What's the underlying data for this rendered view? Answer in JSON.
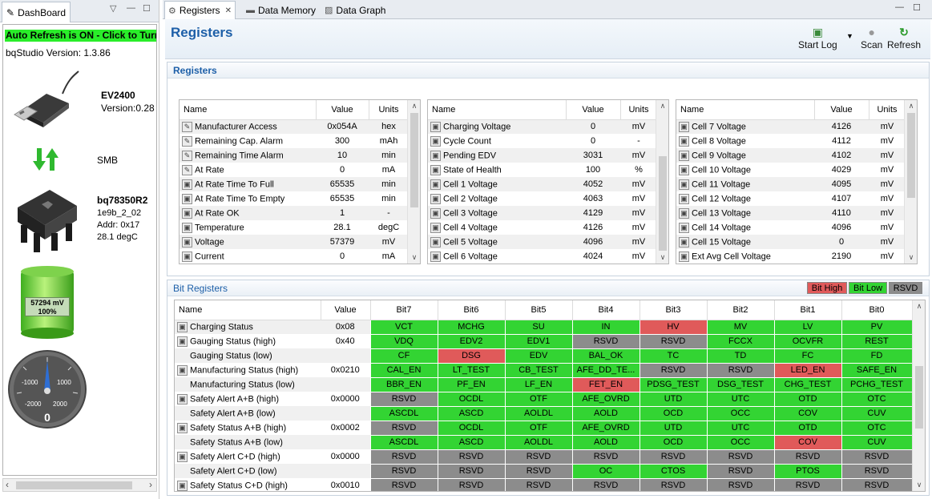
{
  "dashboard": {
    "tab_label": "DashBoard",
    "auto_refresh": "Auto Refresh is ON - Click to Turn",
    "version": "bqStudio Version:  1.3.86",
    "device_name": "EV2400",
    "device_version": "Version:0.28",
    "bus": "SMB",
    "chip_name": "bq78350R2",
    "chip_lines": [
      "1e9b_2_02",
      "Addr: 0x17",
      "28.1 degC"
    ],
    "battery_mv": "57294 mV",
    "battery_pct": "100%",
    "battery_level": 1.0,
    "gauge_labels": {
      "neg1000": "-1000",
      "pos1000": "1000",
      "neg2000": "-2000",
      "pos2000": "2000",
      "value": "0"
    },
    "gauge_value": 0
  },
  "tabs": [
    {
      "label": "Registers",
      "icon": "gear-icon"
    },
    {
      "label": "Data Memory",
      "icon": "memory-chip-icon"
    },
    {
      "label": "Data Graph",
      "icon": "graph-icon"
    }
  ],
  "header": {
    "title": "Registers",
    "start_log": "Start Log",
    "scan": "Scan",
    "refresh": "Refresh"
  },
  "registers": {
    "section_title": "Registers",
    "columns": {
      "name": "Name",
      "value": "Value",
      "units": "Units"
    },
    "table1": [
      {
        "icon": "pencil-icon",
        "name": "Manufacturer Access",
        "value": "0x054A",
        "units": "hex"
      },
      {
        "icon": "pencil-icon",
        "name": "Remaining Cap. Alarm",
        "value": "300",
        "units": "mAh"
      },
      {
        "icon": "pencil-icon",
        "name": "Remaining Time Alarm",
        "value": "10",
        "units": "min"
      },
      {
        "icon": "pencil-icon",
        "name": "At Rate",
        "value": "0",
        "units": "mA"
      },
      {
        "icon": "lock-icon",
        "name": "At Rate Time To Full",
        "value": "65535",
        "units": "min"
      },
      {
        "icon": "lock-icon",
        "name": "At Rate Time To Empty",
        "value": "65535",
        "units": "min"
      },
      {
        "icon": "lock-icon",
        "name": "At Rate OK",
        "value": "1",
        "units": "-"
      },
      {
        "icon": "lock-icon",
        "name": "Temperature",
        "value": "28.1",
        "units": "degC"
      },
      {
        "icon": "lock-icon",
        "name": "Voltage",
        "value": "57379",
        "units": "mV"
      },
      {
        "icon": "lock-icon",
        "name": "Current",
        "value": "0",
        "units": "mA"
      }
    ],
    "table2": [
      {
        "icon": "lock-icon",
        "name": "Charging Voltage",
        "value": "0",
        "units": "mV"
      },
      {
        "icon": "lock-icon",
        "name": "Cycle Count",
        "value": "0",
        "units": "-"
      },
      {
        "icon": "lock-icon",
        "name": "Pending EDV",
        "value": "3031",
        "units": "mV"
      },
      {
        "icon": "lock-icon",
        "name": "State of Health",
        "value": "100",
        "units": "%"
      },
      {
        "icon": "lock-icon",
        "name": "Cell 1 Voltage",
        "value": "4052",
        "units": "mV"
      },
      {
        "icon": "lock-icon",
        "name": "Cell 2 Voltage",
        "value": "4063",
        "units": "mV"
      },
      {
        "icon": "lock-icon",
        "name": "Cell 3 Voltage",
        "value": "4129",
        "units": "mV"
      },
      {
        "icon": "lock-icon",
        "name": "Cell 4 Voltage",
        "value": "4126",
        "units": "mV"
      },
      {
        "icon": "lock-icon",
        "name": "Cell 5 Voltage",
        "value": "4096",
        "units": "mV"
      },
      {
        "icon": "lock-icon",
        "name": "Cell 6 Voltage",
        "value": "4024",
        "units": "mV"
      }
    ],
    "table3": [
      {
        "icon": "lock-icon",
        "name": "Cell 7 Voltage",
        "value": "4126",
        "units": "mV"
      },
      {
        "icon": "lock-icon",
        "name": "Cell 8 Voltage",
        "value": "4112",
        "units": "mV"
      },
      {
        "icon": "lock-icon",
        "name": "Cell 9 Voltage",
        "value": "4102",
        "units": "mV"
      },
      {
        "icon": "lock-icon",
        "name": "Cell 10 Voltage",
        "value": "4029",
        "units": "mV"
      },
      {
        "icon": "lock-icon",
        "name": "Cell 11 Voltage",
        "value": "4095",
        "units": "mV"
      },
      {
        "icon": "lock-icon",
        "name": "Cell 12 Voltage",
        "value": "4107",
        "units": "mV"
      },
      {
        "icon": "lock-icon",
        "name": "Cell 13 Voltage",
        "value": "4110",
        "units": "mV"
      },
      {
        "icon": "lock-icon",
        "name": "Cell 14 Voltage",
        "value": "4096",
        "units": "mV"
      },
      {
        "icon": "lock-icon",
        "name": "Cell 15 Voltage",
        "value": "0",
        "units": "mV"
      },
      {
        "icon": "lock-icon",
        "name": "Ext Avg Cell Voltage",
        "value": "2190",
        "units": "mV"
      }
    ]
  },
  "bit_registers": {
    "section_title": "Bit Registers",
    "legend": {
      "high": "Bit High",
      "low": "Bit Low",
      "rsvd": "RSVD"
    },
    "colors": {
      "high": "#e05a5a",
      "low": "#33d433",
      "rsvd": "#8c8c8c"
    },
    "columns": [
      "Name",
      "Value",
      "Bit7",
      "Bit6",
      "Bit5",
      "Bit4",
      "Bit3",
      "Bit2",
      "Bit1",
      "Bit0"
    ],
    "rows": [
      {
        "lock": true,
        "name": "Charging Status",
        "value": "0x08",
        "bits": [
          [
            "VCT",
            "low"
          ],
          [
            "MCHG",
            "low"
          ],
          [
            "SU",
            "low"
          ],
          [
            "IN",
            "low"
          ],
          [
            "HV",
            "high"
          ],
          [
            "MV",
            "low"
          ],
          [
            "LV",
            "low"
          ],
          [
            "PV",
            "low"
          ]
        ]
      },
      {
        "lock": true,
        "name": "Gauging Status (high)",
        "value": "0x40",
        "bits": [
          [
            "VDQ",
            "low"
          ],
          [
            "EDV2",
            "low"
          ],
          [
            "EDV1",
            "low"
          ],
          [
            "RSVD",
            "rsvd"
          ],
          [
            "RSVD",
            "rsvd"
          ],
          [
            "FCCX",
            "low"
          ],
          [
            "OCVFR",
            "low"
          ],
          [
            "REST",
            "low"
          ]
        ]
      },
      {
        "lock": false,
        "name": "Gauging Status (low)",
        "value": "",
        "bits": [
          [
            "CF",
            "low"
          ],
          [
            "DSG",
            "high"
          ],
          [
            "EDV",
            "low"
          ],
          [
            "BAL_OK",
            "low"
          ],
          [
            "TC",
            "low"
          ],
          [
            "TD",
            "low"
          ],
          [
            "FC",
            "low"
          ],
          [
            "FD",
            "low"
          ]
        ]
      },
      {
        "lock": true,
        "name": "Manufacturing Status (high)",
        "value": "0x0210",
        "bits": [
          [
            "CAL_EN",
            "low"
          ],
          [
            "LT_TEST",
            "low"
          ],
          [
            "CB_TEST",
            "low"
          ],
          [
            "AFE_DD_TE...",
            "low"
          ],
          [
            "RSVD",
            "rsvd"
          ],
          [
            "RSVD",
            "rsvd"
          ],
          [
            "LED_EN",
            "high"
          ],
          [
            "SAFE_EN",
            "low"
          ]
        ]
      },
      {
        "lock": false,
        "name": "Manufacturing Status (low)",
        "value": "",
        "bits": [
          [
            "BBR_EN",
            "low"
          ],
          [
            "PF_EN",
            "low"
          ],
          [
            "LF_EN",
            "low"
          ],
          [
            "FET_EN",
            "high"
          ],
          [
            "PDSG_TEST",
            "low"
          ],
          [
            "DSG_TEST",
            "low"
          ],
          [
            "CHG_TEST",
            "low"
          ],
          [
            "PCHG_TEST",
            "low"
          ]
        ]
      },
      {
        "lock": true,
        "name": "Safety Alert A+B (high)",
        "value": "0x0000",
        "bits": [
          [
            "RSVD",
            "rsvd"
          ],
          [
            "OCDL",
            "low"
          ],
          [
            "OTF",
            "low"
          ],
          [
            "AFE_OVRD",
            "low"
          ],
          [
            "UTD",
            "low"
          ],
          [
            "UTC",
            "low"
          ],
          [
            "OTD",
            "low"
          ],
          [
            "OTC",
            "low"
          ]
        ]
      },
      {
        "lock": false,
        "name": "Safety Alert A+B (low)",
        "value": "",
        "bits": [
          [
            "ASCDL",
            "low"
          ],
          [
            "ASCD",
            "low"
          ],
          [
            "AOLDL",
            "low"
          ],
          [
            "AOLD",
            "low"
          ],
          [
            "OCD",
            "low"
          ],
          [
            "OCC",
            "low"
          ],
          [
            "COV",
            "low"
          ],
          [
            "CUV",
            "low"
          ]
        ]
      },
      {
        "lock": true,
        "name": "Safety Status A+B (high)",
        "value": "0x0002",
        "bits": [
          [
            "RSVD",
            "rsvd"
          ],
          [
            "OCDL",
            "low"
          ],
          [
            "OTF",
            "low"
          ],
          [
            "AFE_OVRD",
            "low"
          ],
          [
            "UTD",
            "low"
          ],
          [
            "UTC",
            "low"
          ],
          [
            "OTD",
            "low"
          ],
          [
            "OTC",
            "low"
          ]
        ]
      },
      {
        "lock": false,
        "name": "Safety Status A+B (low)",
        "value": "",
        "bits": [
          [
            "ASCDL",
            "low"
          ],
          [
            "ASCD",
            "low"
          ],
          [
            "AOLDL",
            "low"
          ],
          [
            "AOLD",
            "low"
          ],
          [
            "OCD",
            "low"
          ],
          [
            "OCC",
            "low"
          ],
          [
            "COV",
            "high"
          ],
          [
            "CUV",
            "low"
          ]
        ]
      },
      {
        "lock": true,
        "name": "Safety Alert C+D (high)",
        "value": "0x0000",
        "bits": [
          [
            "RSVD",
            "rsvd"
          ],
          [
            "RSVD",
            "rsvd"
          ],
          [
            "RSVD",
            "rsvd"
          ],
          [
            "RSVD",
            "rsvd"
          ],
          [
            "RSVD",
            "rsvd"
          ],
          [
            "RSVD",
            "rsvd"
          ],
          [
            "RSVD",
            "rsvd"
          ],
          [
            "RSVD",
            "rsvd"
          ]
        ]
      },
      {
        "lock": false,
        "name": "Safety Alert C+D (low)",
        "value": "",
        "bits": [
          [
            "RSVD",
            "rsvd"
          ],
          [
            "RSVD",
            "rsvd"
          ],
          [
            "RSVD",
            "rsvd"
          ],
          [
            "OC",
            "low"
          ],
          [
            "CTOS",
            "low"
          ],
          [
            "RSVD",
            "rsvd"
          ],
          [
            "PTOS",
            "low"
          ],
          [
            "RSVD",
            "rsvd"
          ]
        ]
      },
      {
        "lock": true,
        "name": "Safety Status C+D (high)",
        "value": "0x0010",
        "bits": [
          [
            "RSVD",
            "rsvd"
          ],
          [
            "RSVD",
            "rsvd"
          ],
          [
            "RSVD",
            "rsvd"
          ],
          [
            "RSVD",
            "rsvd"
          ],
          [
            "RSVD",
            "rsvd"
          ],
          [
            "RSVD",
            "rsvd"
          ],
          [
            "RSVD",
            "rsvd"
          ],
          [
            "RSVD",
            "rsvd"
          ]
        ]
      }
    ]
  }
}
